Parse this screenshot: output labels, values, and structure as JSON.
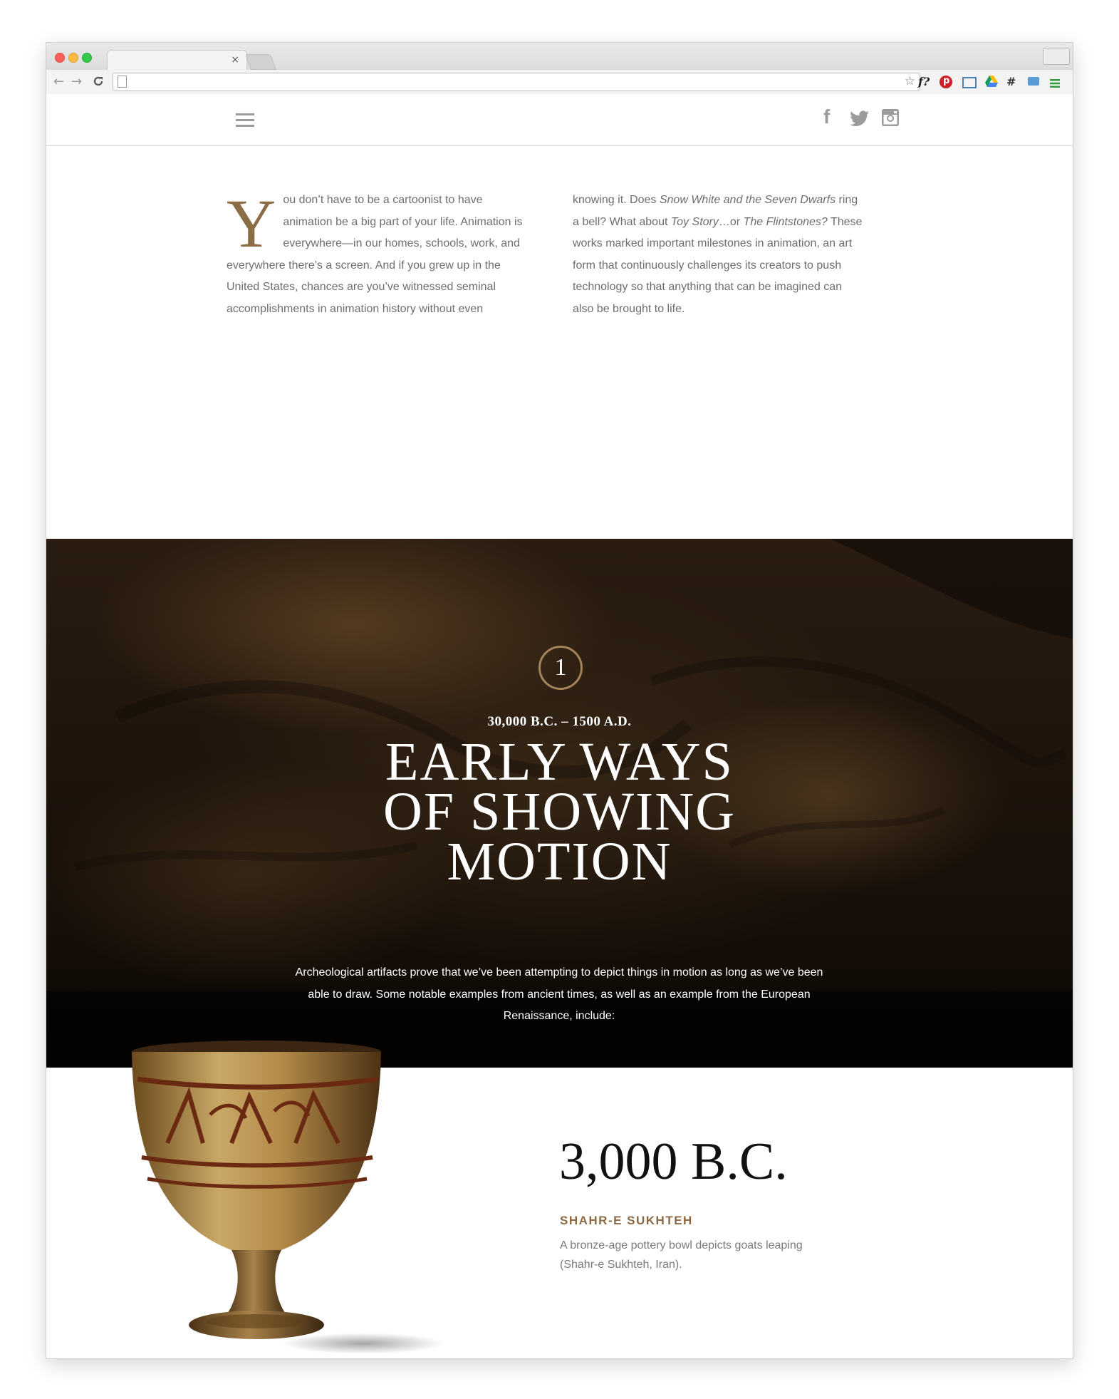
{
  "browser": {
    "tab_close": "×",
    "nav": {
      "back": "←",
      "forward": "→",
      "reload": "C"
    },
    "extensions": [
      "star-icon",
      "font-icon",
      "pinterest-icon",
      "screen-capture-icon",
      "drive-icon",
      "hash-icon",
      "camera-icon",
      "menu-icon"
    ],
    "font_ext_label": "f?"
  },
  "header": {
    "social": [
      "facebook-icon",
      "twitter-icon",
      "instagram-icon"
    ],
    "facebook_glyph": "f"
  },
  "intro": {
    "dropcap": "Y",
    "col1_after_cap": "ou don’t have to be a cartoonist to have animation be a big part of your life. Animation is everywhere—in our homes, schools, work, and everywhere there’s a screen. And if you grew up in the United States, chances are you’ve witnessed seminal accomplishments in animation history without even",
    "col2_part1": "knowing it. Does ",
    "col2_em1": "Snow White and the Seven Dwarfs",
    "col2_part2": " ring a bell? What about ",
    "col2_em2": "Toy Story",
    "col2_part3": "…or ",
    "col2_em3": "The Flintstones?",
    "col2_part4": " These works marked important milestones in animation, an art form that continuously challenges its creators to push technology so that anything that can be imagined can also be brought to life."
  },
  "section": {
    "number": "1",
    "era": "30,000 B.C. – 1500 A.D.",
    "title_line1": "EARLY WAYS",
    "title_line2": "OF SHOWING",
    "title_line3": "MOTION",
    "body": "Archeological artifacts prove that we’ve been attempting to depict things in motion as long as we’ve been able to draw. Some notable examples from ancient times, as well as an example from the European Renaissance, include:"
  },
  "entry": {
    "year": "3,000 B.C.",
    "heading": "SHAHR-E SUKHTEH",
    "text": "A bronze-age pottery bowl depicts goats leaping (Shahr-e Sukhteh, Iran)."
  },
  "colors": {
    "accent": "#8c6b44",
    "ring": "#a3845a",
    "body_text": "#6e6e6e",
    "hero_bg": "#1a110a"
  }
}
